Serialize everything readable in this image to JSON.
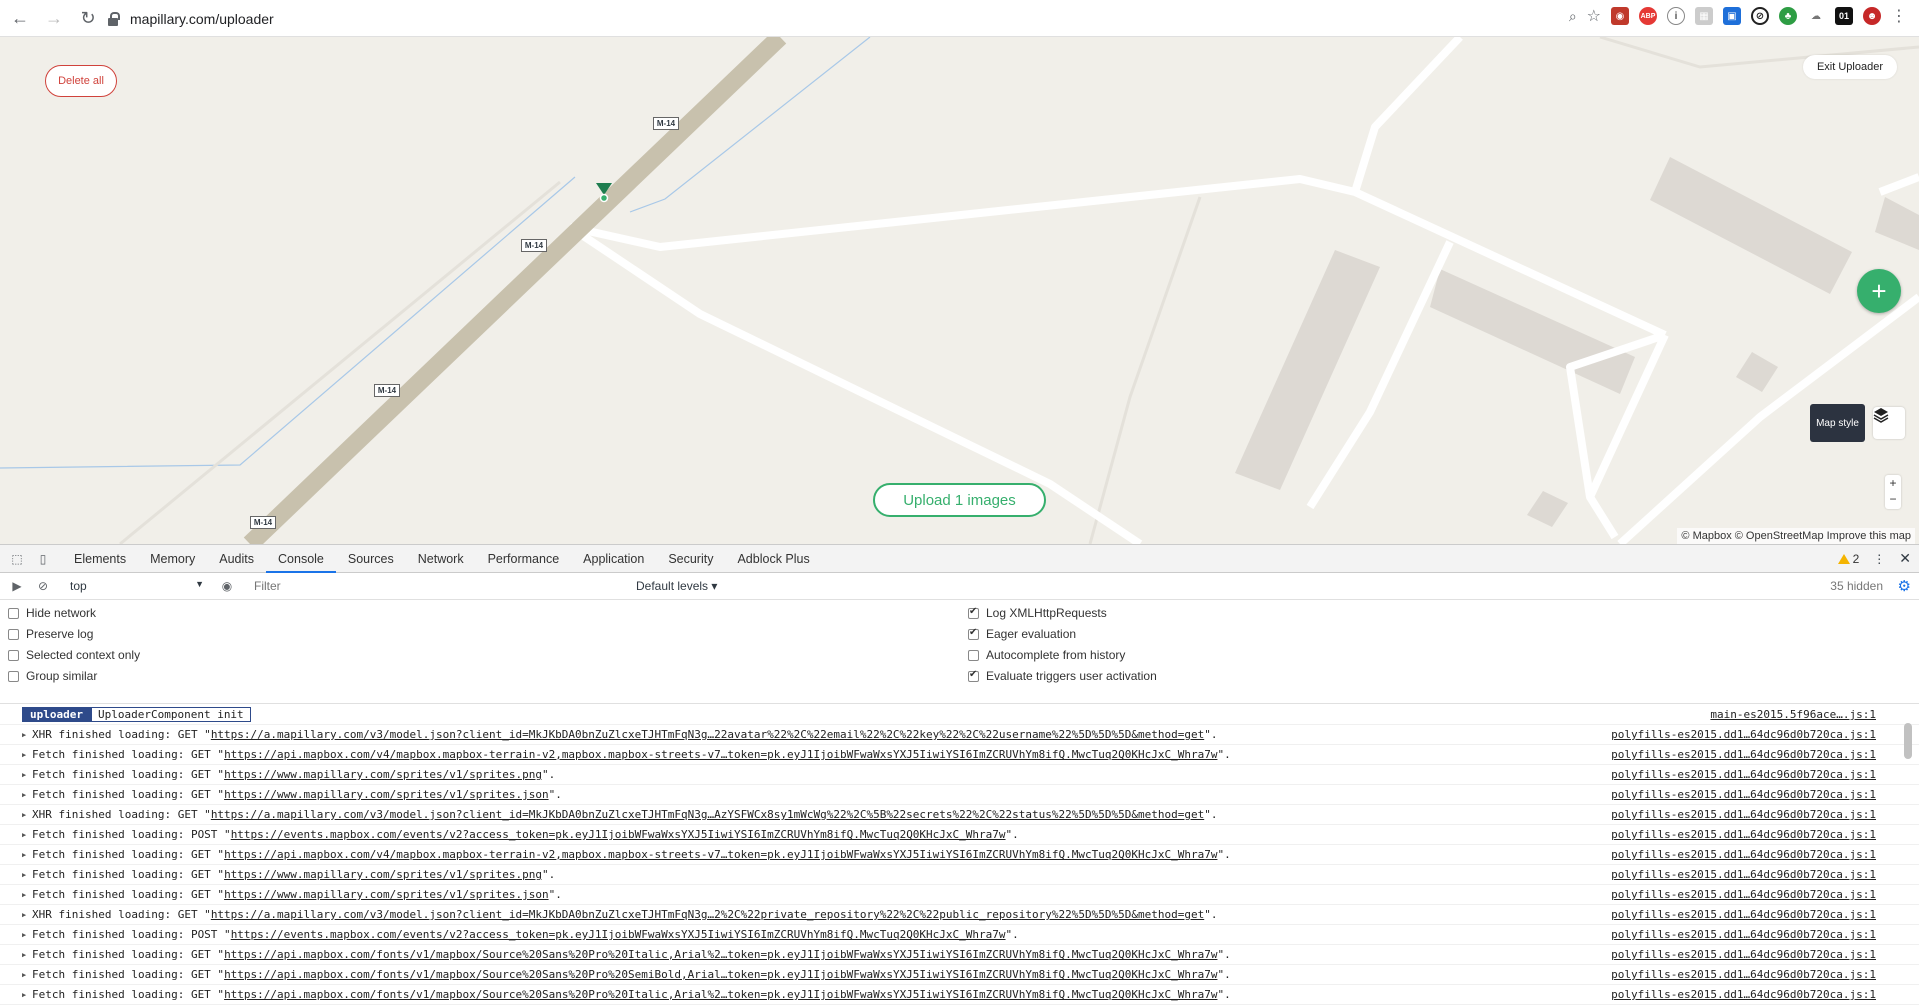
{
  "browser": {
    "url": "mapillary.com/uploader"
  },
  "map": {
    "delete_all": "Delete all",
    "exit_uploader": "Exit Uploader",
    "plus_label": "+",
    "map_style_tip": "Map style",
    "zoom_in": "+",
    "zoom_out": "−",
    "upload_button": "Upload 1 images",
    "attribution": "© Mapbox © OpenStreetMap  Improve this map",
    "road_labels": [
      "M-14",
      "M-14",
      "M-14",
      "M-14"
    ],
    "colors": {
      "accent": "#36af6d",
      "danger": "#d0423b",
      "land": "#f1efe9",
      "road": "#c8c1ad"
    }
  },
  "devtools": {
    "tabs": [
      "Elements",
      "Memory",
      "Audits",
      "Console",
      "Sources",
      "Network",
      "Performance",
      "Application",
      "Security",
      "Adblock Plus"
    ],
    "active_tab": "Console",
    "warning_count": "2",
    "context": "top",
    "filter_placeholder": "Filter",
    "levels": "Default levels ▾",
    "hidden": "35 hidden",
    "settings_left": [
      {
        "label": "Hide network",
        "checked": false
      },
      {
        "label": "Preserve log",
        "checked": false
      },
      {
        "label": "Selected context only",
        "checked": false
      },
      {
        "label": "Group similar",
        "checked": false
      }
    ],
    "settings_right": [
      {
        "label": "Log XMLHttpRequests",
        "checked": true
      },
      {
        "label": "Eager evaluation",
        "checked": true
      },
      {
        "label": "Autocomplete from history",
        "checked": false
      },
      {
        "label": "Evaluate triggers user activation",
        "checked": true
      }
    ],
    "first_log": {
      "tag": "uploader",
      "text": "UploaderComponent init",
      "source": "main-es2015.5f96ace….js:1"
    },
    "logs": [
      {
        "prefix": "XHR finished loading: GET \"",
        "url": "https://a.mapillary.com/v3/model.json?client_id=MkJKbDA0bnZuZlcxeTJHTmFqN3g…22avatar%22%2C%22email%22%2C%22key%22%2C%22username%22%5D%5D%5D&method=get",
        "suffix": "\".",
        "source": "polyfills-es2015.dd1…64dc96d0b720ca.js:1"
      },
      {
        "prefix": "Fetch finished loading: GET \"",
        "url": "https://api.mapbox.com/v4/mapbox.mapbox-terrain-v2,mapbox.mapbox-streets-v7…token=pk.eyJ1IjoibWFwaWxsYXJ5IiwiYSI6ImZCRUVhYm8ifQ.MwcTuq2Q0KHcJxC_Whra7w",
        "suffix": "\".",
        "source": "polyfills-es2015.dd1…64dc96d0b720ca.js:1"
      },
      {
        "prefix": "Fetch finished loading: GET \"",
        "url": "https://www.mapillary.com/sprites/v1/sprites.png",
        "suffix": "\".",
        "source": "polyfills-es2015.dd1…64dc96d0b720ca.js:1"
      },
      {
        "prefix": "Fetch finished loading: GET \"",
        "url": "https://www.mapillary.com/sprites/v1/sprites.json",
        "suffix": "\".",
        "source": "polyfills-es2015.dd1…64dc96d0b720ca.js:1"
      },
      {
        "prefix": "XHR finished loading: GET \"",
        "url": "https://a.mapillary.com/v3/model.json?client_id=MkJKbDA0bnZuZlcxeTJHTmFqN3g…AzYSFWCx8sy1mWcWg%22%2C%5B%22secrets%22%2C%22status%22%5D%5D%5D&method=get",
        "suffix": "\".",
        "source": "polyfills-es2015.dd1…64dc96d0b720ca.js:1"
      },
      {
        "prefix": "Fetch finished loading: POST \"",
        "url": "https://events.mapbox.com/events/v2?access_token=pk.eyJ1IjoibWFwaWxsYXJ5IiwiYSI6ImZCRUVhYm8ifQ.MwcTuq2Q0KHcJxC_Whra7w",
        "suffix": "\".",
        "source": "polyfills-es2015.dd1…64dc96d0b720ca.js:1"
      },
      {
        "prefix": "Fetch finished loading: GET \"",
        "url": "https://api.mapbox.com/v4/mapbox.mapbox-terrain-v2,mapbox.mapbox-streets-v7…token=pk.eyJ1IjoibWFwaWxsYXJ5IiwiYSI6ImZCRUVhYm8ifQ.MwcTuq2Q0KHcJxC_Whra7w",
        "suffix": "\".",
        "source": "polyfills-es2015.dd1…64dc96d0b720ca.js:1"
      },
      {
        "prefix": "Fetch finished loading: GET \"",
        "url": "https://www.mapillary.com/sprites/v1/sprites.png",
        "suffix": "\".",
        "source": "polyfills-es2015.dd1…64dc96d0b720ca.js:1"
      },
      {
        "prefix": "Fetch finished loading: GET \"",
        "url": "https://www.mapillary.com/sprites/v1/sprites.json",
        "suffix": "\".",
        "source": "polyfills-es2015.dd1…64dc96d0b720ca.js:1"
      },
      {
        "prefix": "XHR finished loading: GET \"",
        "url": "https://a.mapillary.com/v3/model.json?client_id=MkJKbDA0bnZuZlcxeTJHTmFqN3g…2%2C%22private_repository%22%2C%22public_repository%22%5D%5D%5D&method=get",
        "suffix": "\".",
        "source": "polyfills-es2015.dd1…64dc96d0b720ca.js:1"
      },
      {
        "prefix": "Fetch finished loading: POST \"",
        "url": "https://events.mapbox.com/events/v2?access_token=pk.eyJ1IjoibWFwaWxsYXJ5IiwiYSI6ImZCRUVhYm8ifQ.MwcTuq2Q0KHcJxC_Whra7w",
        "suffix": "\".",
        "source": "polyfills-es2015.dd1…64dc96d0b720ca.js:1"
      },
      {
        "prefix": "Fetch finished loading: GET \"",
        "url": "https://api.mapbox.com/fonts/v1/mapbox/Source%20Sans%20Pro%20Italic,Arial%2…token=pk.eyJ1IjoibWFwaWxsYXJ5IiwiYSI6ImZCRUVhYm8ifQ.MwcTuq2Q0KHcJxC_Whra7w",
        "suffix": "\".",
        "source": "polyfills-es2015.dd1…64dc96d0b720ca.js:1"
      },
      {
        "prefix": "Fetch finished loading: GET \"",
        "url": "https://api.mapbox.com/fonts/v1/mapbox/Source%20Sans%20Pro%20SemiBold,Arial…token=pk.eyJ1IjoibWFwaWxsYXJ5IiwiYSI6ImZCRUVhYm8ifQ.MwcTuq2Q0KHcJxC_Whra7w",
        "suffix": "\".",
        "source": "polyfills-es2015.dd1…64dc96d0b720ca.js:1"
      },
      {
        "prefix": "Fetch finished loading: GET \"",
        "url": "https://api.mapbox.com/fonts/v1/mapbox/Source%20Sans%20Pro%20Italic,Arial%2…token=pk.eyJ1IjoibWFwaWxsYXJ5IiwiYSI6ImZCRUVhYm8ifQ.MwcTuq2Q0KHcJxC_Whra7w",
        "suffix": "\".",
        "source": "polyfills-es2015.dd1…64dc96d0b720ca.js:1"
      }
    ]
  }
}
